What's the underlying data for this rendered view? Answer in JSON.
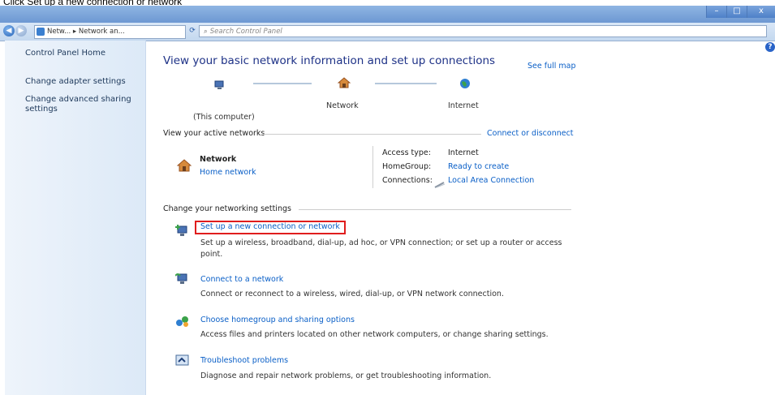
{
  "instruction": "Click Set up a new connection or network",
  "window": {
    "minimize": "–",
    "maximize": "□",
    "close": "x"
  },
  "address_bar": {
    "back": "◀",
    "forward": "▶",
    "path": "Netw... ▸ Network an...",
    "search_placeholder": "Search Control Panel",
    "search_icon": "search-icon"
  },
  "sidebar": {
    "items": [
      "Control Panel Home",
      "Change adapter settings",
      "Change advanced sharing settings"
    ]
  },
  "main": {
    "title": "View your basic network information and set up connections",
    "see_full_map": "See full map",
    "map": {
      "computer": "(This computer)",
      "network": "Network",
      "internet": "Internet"
    },
    "active_networks_label": "View your active networks",
    "connect_or_disconnect": "Connect or disconnect",
    "network": {
      "name": "Network",
      "type": "Home network"
    },
    "details": {
      "access_type_label": "Access type:",
      "access_type_value": "Internet",
      "homegroup_label": "HomeGroup:",
      "homegroup_value": "Ready to create",
      "connections_label": "Connections:",
      "connections_value": "Local Area Connection"
    },
    "change_settings_label": "Change your networking settings",
    "tasks": [
      {
        "title": "Set up a new connection or network",
        "desc": "Set up a wireless, broadband, dial-up, ad hoc, or VPN connection; or set up a router or access point."
      },
      {
        "title": "Connect to a network",
        "desc": "Connect or reconnect to a wireless, wired, dial-up, or VPN network connection."
      },
      {
        "title": "Choose homegroup and sharing options",
        "desc": "Access files and printers located on other network computers, or change sharing settings."
      },
      {
        "title": "Troubleshoot problems",
        "desc": "Diagnose and repair network problems, or get troubleshooting information."
      }
    ]
  },
  "colors": {
    "highlight_box": "#e01d1d",
    "link": "#0a5fc7",
    "title": "#1e3287"
  }
}
